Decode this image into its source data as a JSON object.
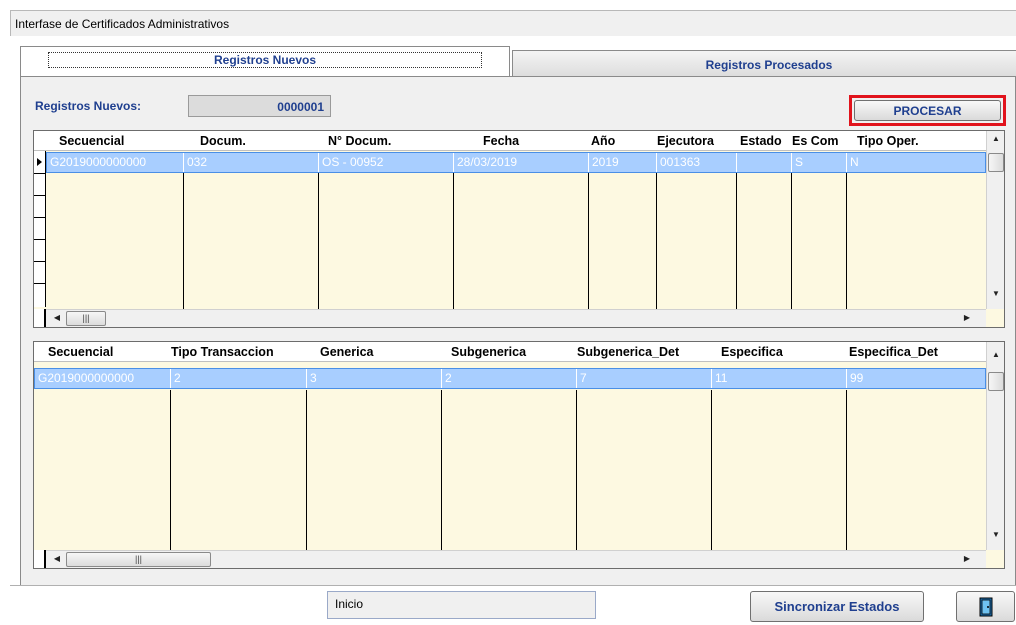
{
  "window": {
    "title": "Interfase de Certificados Administrativos"
  },
  "tabs": [
    {
      "label": "Registros Nuevos"
    },
    {
      "label": "Registros Procesados"
    }
  ],
  "registros": {
    "label": "Registros Nuevos:",
    "value": "0000001"
  },
  "buttons": {
    "procesar": "PROCESAR",
    "sincronizar": "Sincronizar Estados"
  },
  "grid1": {
    "headers": [
      "Secuencial",
      "Docum.",
      "N° Docum.",
      "Fecha",
      "Año",
      "Ejecutora",
      "Estado",
      "Es Com",
      "Tipo Oper."
    ],
    "row": [
      "G2019000000000",
      "032",
      "OS - 00952",
      "28/03/2019",
      "2019",
      "001363",
      "",
      "S",
      "N"
    ]
  },
  "grid2": {
    "headers": [
      "Secuencial",
      "Tipo Transaccion",
      "Generica",
      "Subgenerica",
      "Subgenerica_Det",
      "Especifica",
      "Especifica_Det"
    ],
    "row": [
      "G2019000000000",
      "2",
      "3",
      "2",
      "7",
      "11",
      "99"
    ]
  },
  "status": {
    "text": "Inicio"
  },
  "icons": {
    "exit": "exit-door-icon"
  },
  "colors": {
    "highlight": "#e1131c",
    "selection": "#a8ceff",
    "grid_bg": "#fdf9e1",
    "accent": "#1f3f8f"
  }
}
